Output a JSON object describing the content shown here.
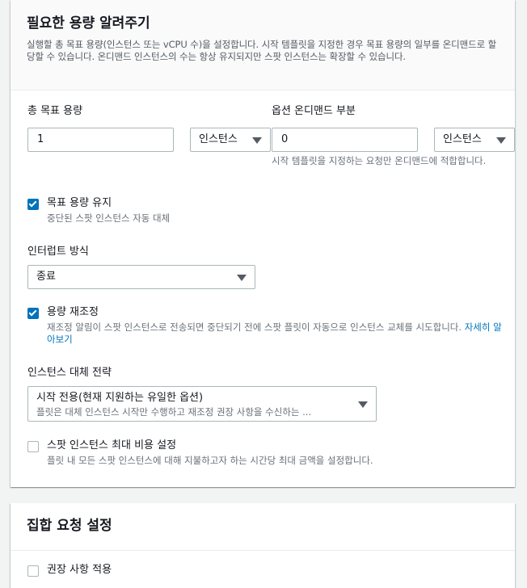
{
  "capacity": {
    "title": "필요한 용량 알려주기",
    "description": "실행할 총 목표 용량(인스턴스 또는 vCPU 수)을 설정합니다. 시작 템플릿을 지정한 경우 목표 용량의 일부를 온디맨드로 할당할 수 있습니다. 온디맨드 인스턴스의 수는 항상 유지되지만 스팟 인스턴스는 확장할 수 있습니다.",
    "total_target": {
      "label": "총 목표 용량",
      "value": "1",
      "unit": "인스턴스"
    },
    "on_demand": {
      "label": "옵션 온디맨드 부분",
      "value": "0",
      "unit": "인스턴스",
      "help": "시작 템플릿을 지정하는 요청만 온디맨드에 적합합니다."
    },
    "maintain": {
      "label": "목표 용량 유지",
      "help": "중단된 스팟 인스턴스 자동 대체",
      "checked": true
    },
    "interruption": {
      "label": "인터럽트 방식",
      "value": "종료"
    },
    "rebalance": {
      "label": "용량 재조정",
      "help": "재조정 알림이 스팟 인스턴스로 전송되면 중단되기 전에 스팟 플릿이 자동으로 인스턴스 교체를 시도합니다.",
      "link": "자세히 알아보기",
      "checked": true
    },
    "replacement": {
      "label": "인스턴스 대체 전략",
      "value": "시작 전용(현재 지원하는 유일한 옵션)",
      "value_help": "플릿은 대체 인스턴스 시작만 수행하고 재조정 권장 사항을 수신하는 ..."
    },
    "max_price": {
      "label": "스팟 인스턴스 최대 비용 설정",
      "help": "플릿 내 모든 스팟 인스턴스에 대해 지불하고자 하는 시간당 최대 금액을 설정합니다.",
      "checked": false
    }
  },
  "aggregate": {
    "title": "집합 요청 설정",
    "recommendations": {
      "label": "권장 사항 적용",
      "checked": false
    }
  }
}
